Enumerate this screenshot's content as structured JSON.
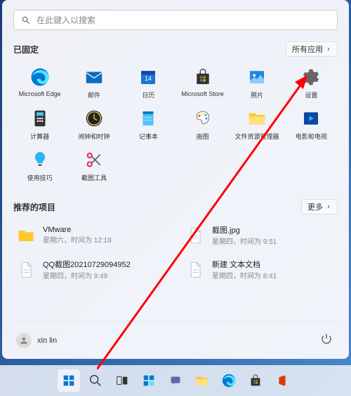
{
  "search": {
    "placeholder": "在此键入以搜索"
  },
  "pinned": {
    "title": "已固定",
    "more": "所有应用",
    "apps": [
      {
        "name": "Microsoft Edge",
        "icon": "edge"
      },
      {
        "name": "邮件",
        "icon": "mail"
      },
      {
        "name": "日历",
        "icon": "calendar"
      },
      {
        "name": "Microsoft Store",
        "icon": "store"
      },
      {
        "name": "照片",
        "icon": "photos"
      },
      {
        "name": "设置",
        "icon": "settings"
      },
      {
        "name": "计算器",
        "icon": "calculator"
      },
      {
        "name": "闹钟和时钟",
        "icon": "clock"
      },
      {
        "name": "记事本",
        "icon": "notepad"
      },
      {
        "name": "画图",
        "icon": "paint"
      },
      {
        "name": "文件资源管理器",
        "icon": "explorer"
      },
      {
        "name": "电影和电视",
        "icon": "movies"
      },
      {
        "name": "使用技巧",
        "icon": "tips"
      },
      {
        "name": "截图工具",
        "icon": "snip"
      }
    ]
  },
  "recommended": {
    "title": "推荐的项目",
    "more": "更多",
    "items": [
      {
        "name": "VMware",
        "time": "星期六，时间为 12:18",
        "icon": "folder"
      },
      {
        "name": "截图.jpg",
        "time": "星期四，时间为 9:51",
        "icon": "file"
      },
      {
        "name": "QQ截图20210729094952",
        "time": "星期四，时间为 9:49",
        "icon": "file"
      },
      {
        "name": "新建 文本文档",
        "time": "星期四，时间为 8:41",
        "icon": "file"
      }
    ]
  },
  "user": {
    "name": "xin lin"
  },
  "taskbar": [
    "start",
    "search",
    "taskview",
    "widgets",
    "chat",
    "explorer",
    "edge",
    "store",
    "office"
  ]
}
